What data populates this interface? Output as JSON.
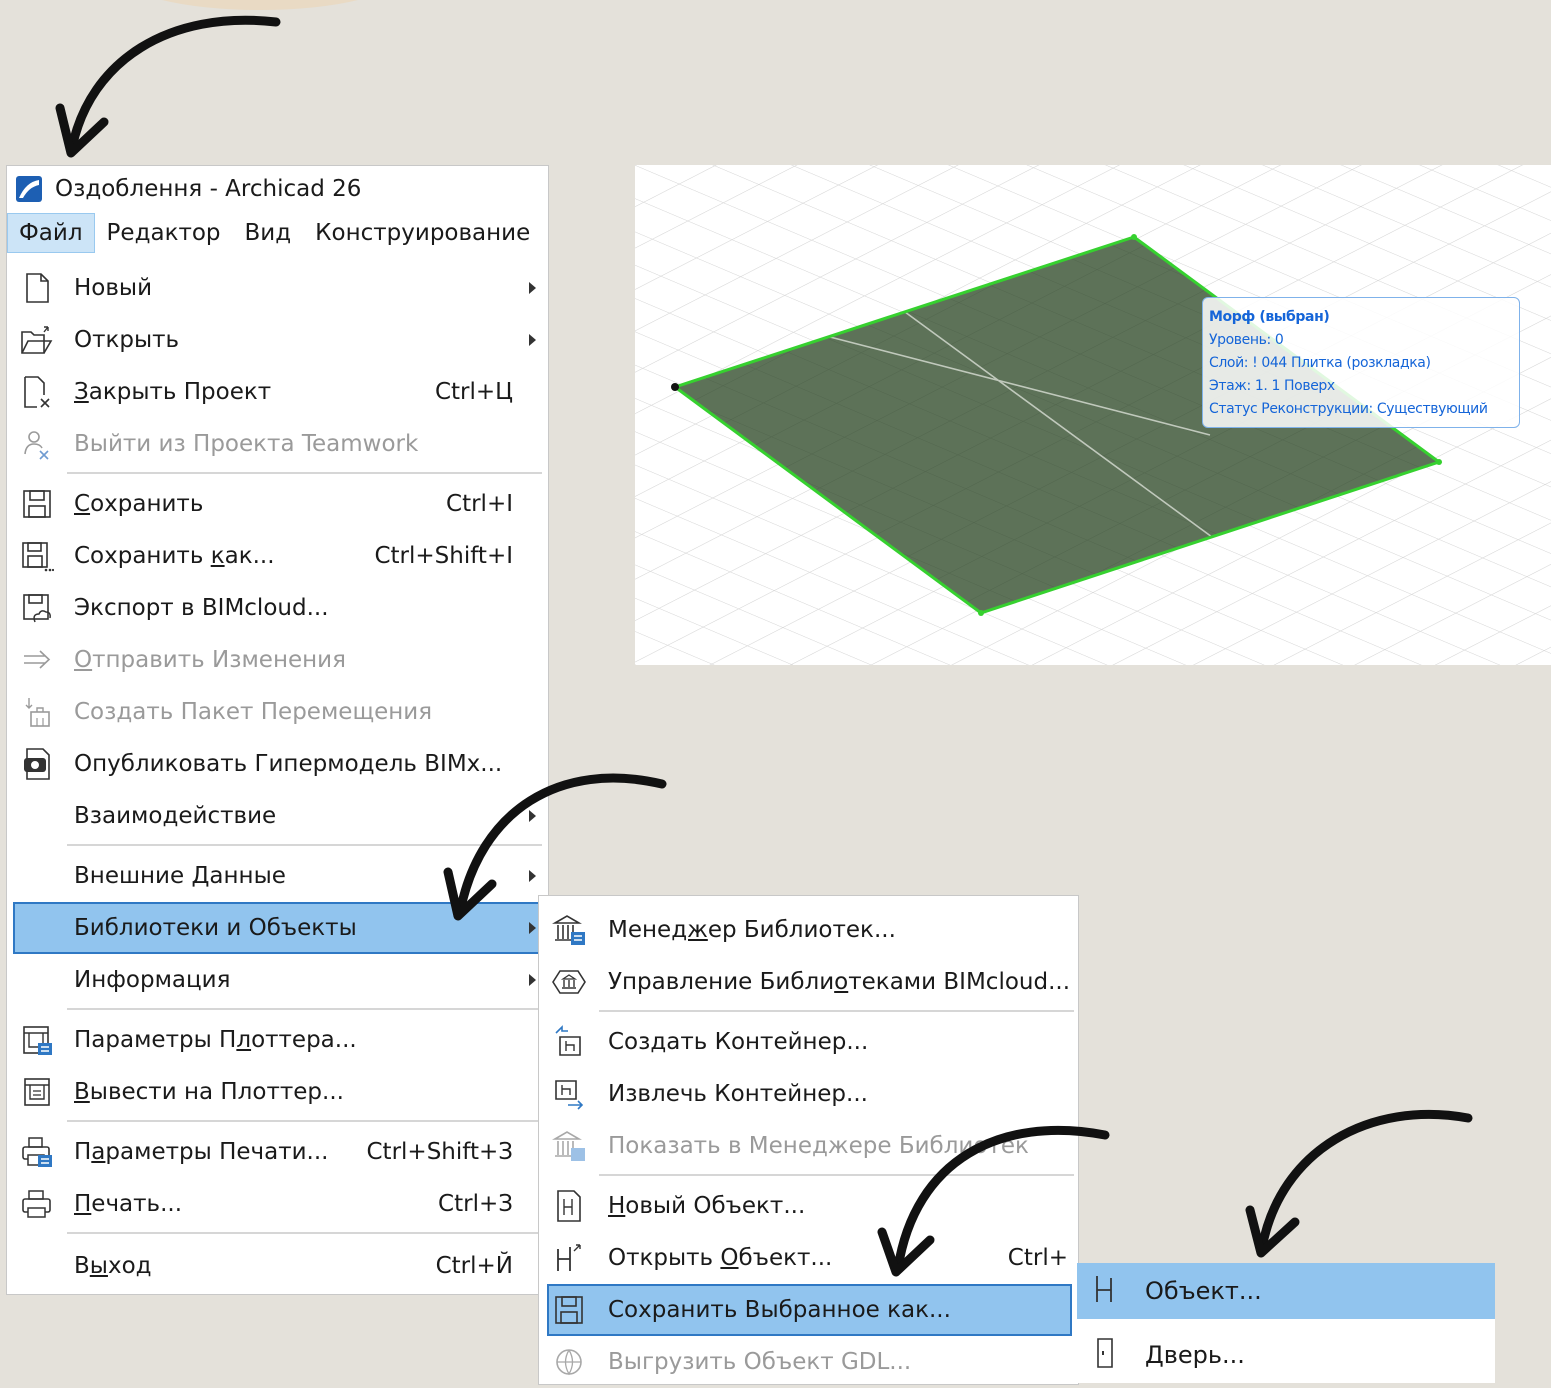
{
  "window": {
    "title": "Оздоблення - Archicad 26"
  },
  "menubar": [
    "Файл",
    "Редактор",
    "Вид",
    "Конструирование"
  ],
  "file_menu": {
    "new": "Новый",
    "open": "Открыть",
    "close_project": "Закрыть Проект",
    "close_project_sc": "Ctrl+Ц",
    "leave_teamwork": "Выйти из Проекта Teamwork",
    "save": "Сохранить",
    "save_sc": "Ctrl+І",
    "save_as": "Сохранить как...",
    "save_as_sc": "Ctrl+Shift+І",
    "export_bimcloud": "Экспорт в BIMcloud...",
    "send_changes": "Отправить Изменения",
    "create_package": "Создать Пакет Перемещения",
    "publish_bimx": "Опубликовать Гипермодель BIMx...",
    "interoperability": "Взаимодействие",
    "external_data": "Внешние Данные",
    "libraries_objects": "Библиотеки и Объекты",
    "info": "Информация",
    "plotter_setup": "Параметры Плоттера...",
    "plot": "Вывести на Плоттер...",
    "print_setup": "Параметры Печати...",
    "print_setup_sc": "Ctrl+Shift+З",
    "print": "Печать...",
    "print_sc": "Ctrl+З",
    "exit": "Выход",
    "exit_sc": "Ctrl+Й"
  },
  "libraries_submenu": {
    "library_manager": "Менеджер Библиотек...",
    "bimcloud_libraries": "Управление Библиотеками BIMcloud...",
    "create_container": "Создать Контейнер...",
    "extract_container": "Извлечь Контейнер...",
    "show_in_manager": "Показать в Менеджере Библиотек",
    "new_object": "Новый Объект...",
    "open_object": "Открыть Объект...",
    "open_object_sc": "Ctrl+",
    "save_selection_as": "Сохранить Выбранное как...",
    "export_gdl": "Выгрузить Объект GDL..."
  },
  "save_as_submenu": {
    "object": "Объект...",
    "door": "Дверь..."
  },
  "tooltip": {
    "title": "Морф (выбран)",
    "level": "Уровень: 0",
    "layer": "Слой: ! 044 Плитка (розкладка)",
    "story": "Этаж: 1. 1 Поверх",
    "status": "Статус Реконструкции: Существующий"
  },
  "colors": {
    "highlight": "#91c4ee",
    "highlight_border": "#2f78c4",
    "morph_fill": "#5d7258",
    "morph_edge": "#36d12f",
    "tooltip_text": "#1565d8",
    "background": "#e4e1da"
  }
}
